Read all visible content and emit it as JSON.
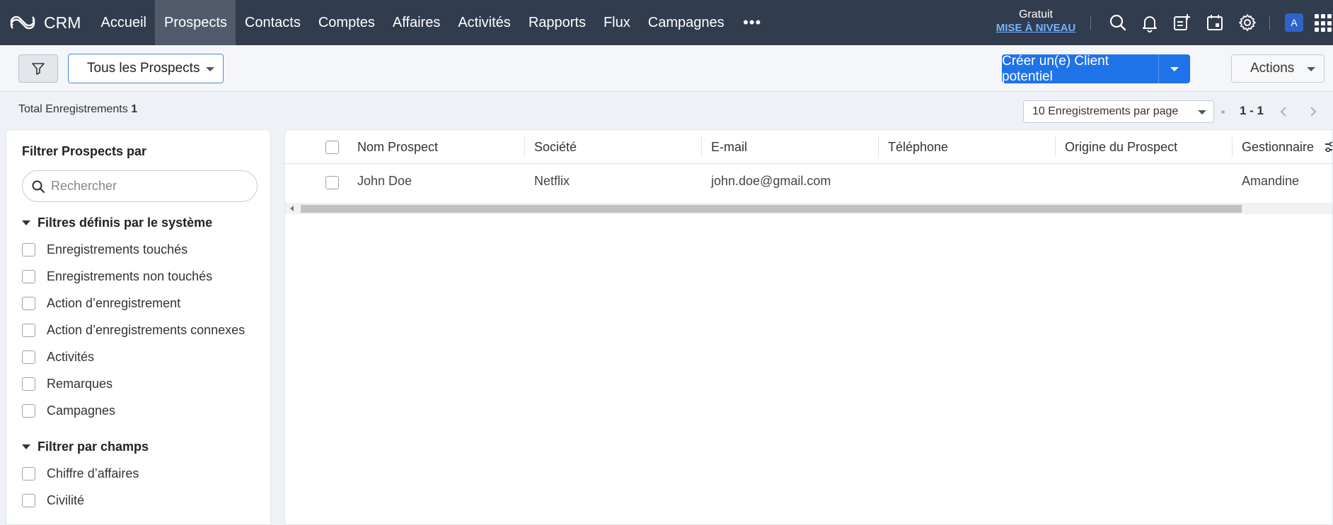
{
  "brand": {
    "name": "CRM"
  },
  "nav": {
    "items": [
      {
        "label": "Accueil"
      },
      {
        "label": "Prospects"
      },
      {
        "label": "Contacts"
      },
      {
        "label": "Comptes"
      },
      {
        "label": "Affaires"
      },
      {
        "label": "Activités"
      },
      {
        "label": "Rapports"
      },
      {
        "label": "Flux"
      },
      {
        "label": "Campagnes"
      }
    ],
    "active": "Prospects",
    "more": "•••"
  },
  "plan": {
    "label": "Gratuit",
    "upgrade": "MISE À NIVEAU"
  },
  "user": {
    "initial": "A"
  },
  "toolbar": {
    "view_label": "Tous les Prospects",
    "create_label": "Créer un(e) Client potentiel",
    "actions_label": "Actions"
  },
  "summary": {
    "total_label": "Total Enregistrements",
    "total_count": "1",
    "per_page": "10 Enregistrements par page",
    "range": "1 - 1"
  },
  "filters": {
    "title": "Filtrer Prospects par",
    "search_placeholder": "Rechercher",
    "system_title": "Filtres définis par le système",
    "system_items": [
      "Enregistrements touchés",
      "Enregistrements non touchés",
      "Action d’enregistrement",
      "Action d’enregistrements connexes",
      "Activités",
      "Remarques",
      "Campagnes"
    ],
    "fields_title": "Filtrer par champs",
    "field_items": [
      "Chiffre d’affaires",
      "Civilité"
    ]
  },
  "table": {
    "columns": [
      "Nom Prospect",
      "Société",
      "E-mail",
      "Téléphone",
      "Origine du Prospect",
      "Gestionnaire"
    ],
    "rows": [
      {
        "name": "John Doe",
        "company": "Netflix",
        "email": "john.doe@gmail.com",
        "phone": "",
        "source": "",
        "owner": "Amandine"
      }
    ]
  }
}
